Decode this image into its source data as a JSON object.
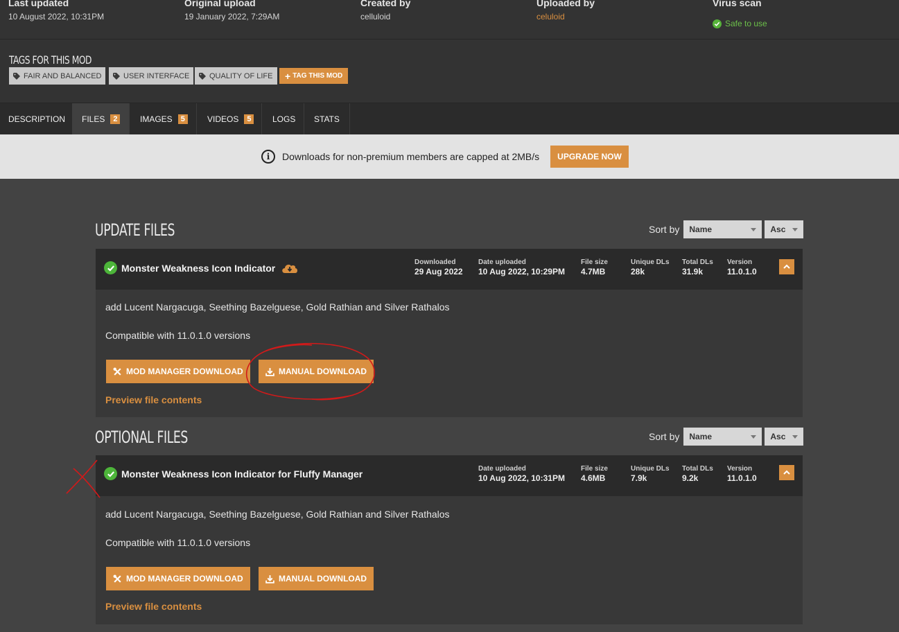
{
  "meta": {
    "last_updated": {
      "label": "Last updated",
      "value": "10 August 2022,  10:31PM"
    },
    "original_upload": {
      "label": "Original upload",
      "value": "19 January 2022,  7:29AM"
    },
    "created_by": {
      "label": "Created by",
      "value": "celluloid"
    },
    "uploaded_by": {
      "label": "Uploaded by",
      "value": "celuloid"
    },
    "virus_scan": {
      "label": "Virus scan",
      "value": "Safe to use"
    }
  },
  "tags": {
    "title": "TAGS FOR THIS MOD",
    "items": [
      "FAIR AND BALANCED",
      "USER INTERFACE",
      "QUALITY OF LIFE"
    ],
    "add_label": "TAG THIS MOD"
  },
  "tabs": [
    {
      "label": "DESCRIPTION"
    },
    {
      "label": "FILES",
      "count": "2",
      "active": true
    },
    {
      "label": "IMAGES",
      "count": "5"
    },
    {
      "label": "VIDEOS",
      "count": "5"
    },
    {
      "label": "LOGS"
    },
    {
      "label": "STATS"
    }
  ],
  "banner": {
    "text": "Downloads for non-premium members are capped at 2MB/s",
    "button": "UPGRADE NOW"
  },
  "sections": [
    {
      "title": "UPDATE FILES",
      "sort_label": "Sort by",
      "sort_field": "Name",
      "sort_order": "Asc",
      "file": {
        "name": "Monster Weakness Icon Indicator",
        "stats": [
          {
            "label": "Downloaded",
            "value": "29 Aug 2022"
          },
          {
            "label": "Date uploaded",
            "value": "10 Aug 2022, 10:29PM"
          },
          {
            "label": "File size",
            "value": "4.7MB"
          },
          {
            "label": "Unique DLs",
            "value": "28k"
          },
          {
            "label": "Total DLs",
            "value": "31.9k"
          },
          {
            "label": "Version",
            "value": "11.0.1.0"
          }
        ],
        "description": "add Lucent Nargacuga, Seething Bazelguese, Gold Rathian and Silver Rathalos",
        "compatibility": "Compatible with 11.0.1.0 versions",
        "mod_manager_button": "MOD MANAGER DOWNLOAD",
        "manual_button": "MANUAL DOWNLOAD",
        "preview": "Preview file contents"
      }
    },
    {
      "title": "OPTIONAL FILES",
      "sort_label": "Sort by",
      "sort_field": "Name",
      "sort_order": "Asc",
      "file": {
        "name": "Monster Weakness Icon Indicator for Fluffy Manager",
        "stats": [
          {
            "label": "Date uploaded",
            "value": "10 Aug 2022, 10:31PM"
          },
          {
            "label": "File size",
            "value": "4.6MB"
          },
          {
            "label": "Unique DLs",
            "value": "7.9k"
          },
          {
            "label": "Total DLs",
            "value": "9.2k"
          },
          {
            "label": "Version",
            "value": "11.0.1.0"
          }
        ],
        "description": "add Lucent Nargacuga, Seething Bazelguese, Gold Rathian and Silver Rathalos",
        "compatibility": "Compatible with 11.0.1.0 versions",
        "mod_manager_button": "MOD MANAGER DOWNLOAD",
        "manual_button": "MANUAL DOWNLOAD",
        "preview": "Preview file contents"
      }
    }
  ],
  "colors": {
    "accent": "#d98f40",
    "safe_green": "#57b33a",
    "annotation_red": "#d11a1a"
  }
}
